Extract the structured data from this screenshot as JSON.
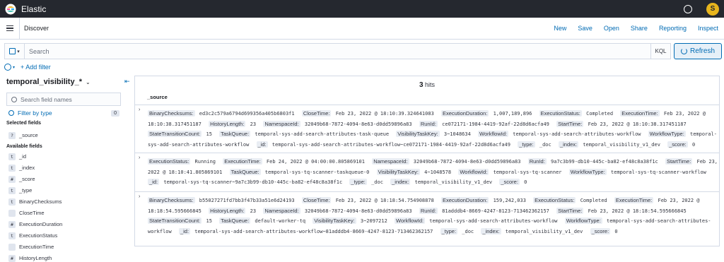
{
  "header": {
    "brand": "Elastic",
    "avatar_initial": "S"
  },
  "nav": {
    "breadcrumb": "Discover",
    "menu": [
      "New",
      "Save",
      "Open",
      "Share",
      "Reporting",
      "Inspect"
    ]
  },
  "query": {
    "placeholder": "Search",
    "language": "KQL",
    "refresh_label": "Refresh"
  },
  "filters": {
    "add_label": "+ Add filter"
  },
  "sidebar": {
    "index_pattern": "temporal_visibility_*",
    "search_placeholder": "Search field names",
    "filter_by_type": "Filter by type",
    "filter_count": "0",
    "selected_title": "Selected fields",
    "selected": [
      {
        "type": "?",
        "name": "_source"
      }
    ],
    "available_title": "Available fields",
    "available": [
      {
        "type": "t",
        "name": "_id"
      },
      {
        "type": "t",
        "name": "_index"
      },
      {
        "type": "#",
        "name": "_score"
      },
      {
        "type": "t",
        "name": "_type"
      },
      {
        "type": "t",
        "name": "BinaryChecksums"
      },
      {
        "type": "",
        "name": "CloseTime"
      },
      {
        "type": "#",
        "name": "ExecutionDuration"
      },
      {
        "type": "t",
        "name": "ExecutionStatus"
      },
      {
        "type": "",
        "name": "ExecutionTime"
      },
      {
        "type": "#",
        "name": "HistoryLength"
      }
    ]
  },
  "results": {
    "hits_count": "3",
    "hits_label": "hits",
    "column": "_source",
    "docs": [
      [
        [
          "BinaryChecksums:",
          "ed3c2c579a6794d699356a405b6803f1"
        ],
        [
          "CloseTime:",
          "Feb 23, 2022 @ 18:10:39.324641083"
        ],
        [
          "ExecutionDuration:",
          "1,007,189,896"
        ],
        [
          "ExecutionStatus:",
          "Completed"
        ],
        [
          "ExecutionTime:",
          "Feb 23, 2022 @ 18:10:38.317451187"
        ],
        [
          "HistoryLength:",
          "23"
        ],
        [
          "NamespaceId:",
          "32049b68-7872-4094-8e63-d0dd59896a83"
        ],
        [
          "RunId:",
          "ce072171-1984-4419-92af-22d8d6acfa49"
        ],
        [
          "StartTime:",
          "Feb 23, 2022 @ 18:10:38.317451187"
        ],
        [
          "StateTransitionCount:",
          "15"
        ],
        [
          "TaskQueue:",
          "temporal-sys-add-search-attributes-task-queue"
        ],
        [
          "VisibilityTaskKey:",
          "3~1048634"
        ],
        [
          "WorkflowId:",
          "temporal-sys-add-search-attributes-workflow"
        ],
        [
          "WorkflowType:",
          "temporal-sys-add-search-attributes-workflow"
        ],
        [
          "_id:",
          "temporal-sys-add-search-attributes-workflow~ce072171-1984-4419-92af-22d8d6acfa49"
        ],
        [
          "_type:",
          "_doc"
        ],
        [
          "_index:",
          "temporal_visibility_v1_dev"
        ],
        [
          "_score:",
          "0"
        ]
      ],
      [
        [
          "ExecutionStatus:",
          "Running"
        ],
        [
          "ExecutionTime:",
          "Feb 24, 2022 @ 04:00:00.805869101"
        ],
        [
          "NamespaceId:",
          "32049b68-7872-4094-8e63-d0dd59896a83"
        ],
        [
          "RunId:",
          "9a7c3b99-db10-445c-ba82-ef48c8a38f1c"
        ],
        [
          "StartTime:",
          "Feb 23, 2022 @ 18:10:41.805869101"
        ],
        [
          "TaskQueue:",
          "temporal-sys-tq-scanner-taskqueue-0"
        ],
        [
          "VisibilityTaskKey:",
          "4~1048578"
        ],
        [
          "WorkflowId:",
          "temporal-sys-tq-scanner"
        ],
        [
          "WorkflowType:",
          "temporal-sys-tq-scanner-workflow"
        ],
        [
          "_id:",
          "temporal-sys-tq-scanner~9a7c3b99-db10-445c-ba82-ef48c8a38f1c"
        ],
        [
          "_type:",
          "_doc"
        ],
        [
          "_index:",
          "temporal_visibility_v1_dev"
        ],
        [
          "_score:",
          "0"
        ]
      ],
      [
        [
          "BinaryChecksums:",
          "b55027271fd7bb3f47b33a51e6d24193"
        ],
        [
          "CloseTime:",
          "Feb 23, 2022 @ 18:18:54.754908878"
        ],
        [
          "ExecutionDuration:",
          "159,242,033"
        ],
        [
          "ExecutionStatus:",
          "Completed"
        ],
        [
          "ExecutionTime:",
          "Feb 23, 2022 @ 18:18:54.595666845"
        ],
        [
          "HistoryLength:",
          "23"
        ],
        [
          "NamespaceId:",
          "32049b68-7872-4094-8e63-d0dd59896a83"
        ],
        [
          "RunId:",
          "81adddb4-8669-4247-8123-713462362157"
        ],
        [
          "StartTime:",
          "Feb 23, 2022 @ 18:18:54.595666845"
        ],
        [
          "StateTransitionCount:",
          "15"
        ],
        [
          "TaskQueue:",
          "default-worker-tq"
        ],
        [
          "VisibilityTaskKey:",
          "3~2097212"
        ],
        [
          "WorkflowId:",
          "temporal-sys-add-search-attributes-workflow"
        ],
        [
          "WorkflowType:",
          "temporal-sys-add-search-attributes-workflow"
        ],
        [
          "_id:",
          "temporal-sys-add-search-attributes-workflow~81adddb4-8669-4247-8123-713462362157"
        ],
        [
          "_type:",
          "_doc"
        ],
        [
          "_index:",
          "temporal_visibility_v1_dev"
        ],
        [
          "_score:",
          "0"
        ]
      ]
    ]
  }
}
